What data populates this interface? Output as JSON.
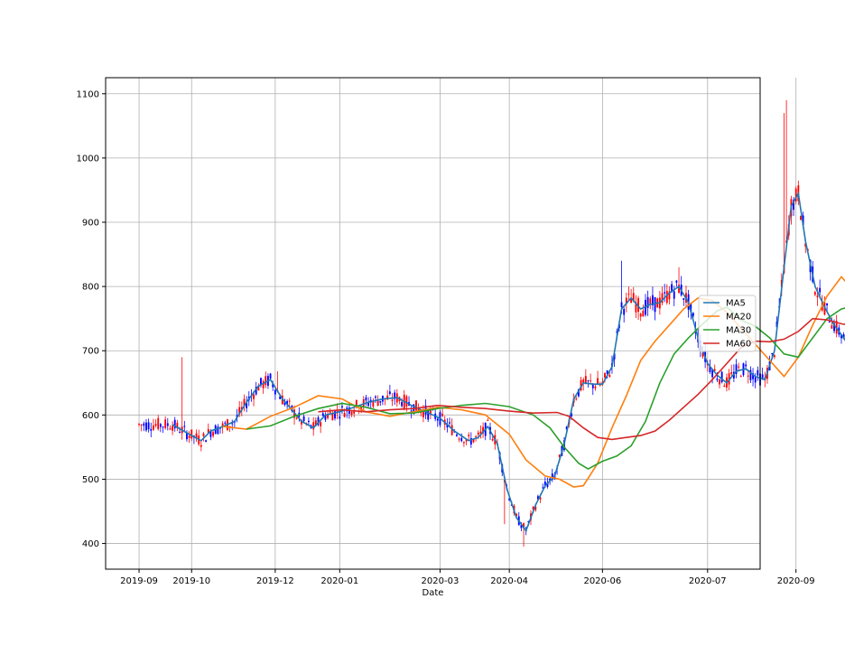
{
  "chart_data": {
    "type": "candlestick",
    "title": "",
    "xlabel": "Date",
    "ylabel": "",
    "ylim": [
      360,
      1125
    ],
    "yticks": [
      400,
      500,
      600,
      700,
      800,
      900,
      1000,
      1100
    ],
    "xticks": [
      "2019-09",
      "2019-10",
      "2019-12",
      "2020-01",
      "2020-03",
      "2020-04",
      "2020-06",
      "2020-07",
      "2020-09"
    ],
    "xlim": [
      -14,
      260
    ],
    "grid": true,
    "legend_position": "center-right",
    "colors": {
      "up": "#ff0000",
      "down": "#0000ff"
    },
    "series": [
      {
        "name": "MA5",
        "color": "#1f77b4",
        "points": [
          [
            14,
            585
          ],
          [
            20,
            572
          ],
          [
            26,
            560
          ],
          [
            30,
            575
          ],
          [
            35,
            582
          ],
          [
            40,
            590
          ],
          [
            45,
            620
          ],
          [
            50,
            645
          ],
          [
            55,
            655
          ],
          [
            60,
            625
          ],
          [
            64,
            608
          ],
          [
            68,
            590
          ],
          [
            73,
            580
          ],
          [
            78,
            600
          ],
          [
            84,
            605
          ],
          [
            90,
            612
          ],
          [
            96,
            620
          ],
          [
            102,
            625
          ],
          [
            108,
            627
          ],
          [
            114,
            615
          ],
          [
            120,
            605
          ],
          [
            126,
            595
          ],
          [
            132,
            575
          ],
          [
            138,
            560
          ],
          [
            142,
            565
          ],
          [
            146,
            582
          ],
          [
            150,
            555
          ],
          [
            154,
            485
          ],
          [
            158,
            440
          ],
          [
            162,
            420
          ],
          [
            166,
            460
          ],
          [
            170,
            490
          ],
          [
            174,
            505
          ],
          [
            178,
            555
          ],
          [
            182,
            625
          ],
          [
            186,
            650
          ],
          [
            190,
            648
          ],
          [
            194,
            648
          ],
          [
            198,
            675
          ],
          [
            202,
            765
          ],
          [
            206,
            782
          ],
          [
            210,
            765
          ],
          [
            214,
            772
          ],
          [
            218,
            775
          ],
          [
            222,
            790
          ],
          [
            226,
            800
          ],
          [
            230,
            775
          ],
          [
            234,
            720
          ],
          [
            238,
            680
          ],
          [
            242,
            662
          ],
          [
            246,
            650
          ],
          [
            250,
            668
          ],
          [
            254,
            672
          ],
          [
            258,
            660
          ],
          [
            262,
            655
          ],
          [
            266,
            700
          ],
          [
            270,
            830
          ],
          [
            273,
            925
          ],
          [
            276,
            945
          ],
          [
            279,
            870
          ],
          [
            283,
            800
          ],
          [
            287,
            768
          ],
          [
            291,
            740
          ],
          [
            295,
            720
          ],
          [
            299,
            695
          ],
          [
            303,
            685
          ],
          [
            307,
            688
          ],
          [
            311,
            700
          ],
          [
            315,
            720
          ],
          [
            320,
            880
          ],
          [
            325,
            900
          ]
        ]
      },
      {
        "name": "MA20",
        "color": "#ff7f0e",
        "points": [
          [
            35,
            582
          ],
          [
            45,
            578
          ],
          [
            55,
            598
          ],
          [
            65,
            612
          ],
          [
            75,
            630
          ],
          [
            85,
            625
          ],
          [
            95,
            605
          ],
          [
            105,
            598
          ],
          [
            115,
            605
          ],
          [
            125,
            612
          ],
          [
            135,
            608
          ],
          [
            145,
            600
          ],
          [
            155,
            570
          ],
          [
            162,
            530
          ],
          [
            170,
            505
          ],
          [
            176,
            500
          ],
          [
            182,
            488
          ],
          [
            186,
            490
          ],
          [
            192,
            525
          ],
          [
            198,
            580
          ],
          [
            204,
            630
          ],
          [
            210,
            685
          ],
          [
            216,
            715
          ],
          [
            222,
            740
          ],
          [
            228,
            765
          ],
          [
            234,
            782
          ],
          [
            240,
            778
          ],
          [
            246,
            760
          ],
          [
            252,
            735
          ],
          [
            258,
            710
          ],
          [
            264,
            685
          ],
          [
            270,
            660
          ],
          [
            276,
            690
          ],
          [
            282,
            740
          ],
          [
            288,
            785
          ],
          [
            294,
            815
          ],
          [
            300,
            790
          ],
          [
            306,
            740
          ],
          [
            312,
            742
          ]
        ]
      },
      {
        "name": "MA30",
        "color": "#2ca02c",
        "points": [
          [
            45,
            578
          ],
          [
            55,
            583
          ],
          [
            65,
            598
          ],
          [
            75,
            610
          ],
          [
            85,
            618
          ],
          [
            95,
            612
          ],
          [
            105,
            602
          ],
          [
            115,
            603
          ],
          [
            125,
            610
          ],
          [
            135,
            615
          ],
          [
            145,
            618
          ],
          [
            155,
            613
          ],
          [
            165,
            600
          ],
          [
            172,
            580
          ],
          [
            178,
            550
          ],
          [
            184,
            525
          ],
          [
            188,
            516
          ],
          [
            194,
            528
          ],
          [
            200,
            536
          ],
          [
            206,
            552
          ],
          [
            212,
            590
          ],
          [
            218,
            650
          ],
          [
            224,
            695
          ],
          [
            230,
            720
          ],
          [
            236,
            742
          ],
          [
            242,
            762
          ],
          [
            246,
            768
          ],
          [
            252,
            748
          ],
          [
            258,
            738
          ],
          [
            264,
            720
          ],
          [
            270,
            695
          ],
          [
            276,
            690
          ],
          [
            282,
            720
          ],
          [
            288,
            750
          ],
          [
            294,
            765
          ],
          [
            300,
            770
          ],
          [
            306,
            780
          ],
          [
            312,
            790
          ],
          [
            318,
            760
          ]
        ]
      },
      {
        "name": "MA60",
        "color": "#d62728",
        "points": [
          [
            75,
            605
          ],
          [
            85,
            608
          ],
          [
            95,
            605
          ],
          [
            105,
            608
          ],
          [
            115,
            610
          ],
          [
            125,
            615
          ],
          [
            135,
            612
          ],
          [
            145,
            610
          ],
          [
            155,
            606
          ],
          [
            165,
            603
          ],
          [
            175,
            604
          ],
          [
            180,
            598
          ],
          [
            186,
            580
          ],
          [
            192,
            565
          ],
          [
            198,
            562
          ],
          [
            204,
            565
          ],
          [
            210,
            568
          ],
          [
            216,
            575
          ],
          [
            222,
            592
          ],
          [
            228,
            612
          ],
          [
            234,
            632
          ],
          [
            240,
            655
          ],
          [
            246,
            680
          ],
          [
            252,
            705
          ],
          [
            258,
            715
          ],
          [
            264,
            714
          ],
          [
            270,
            718
          ],
          [
            276,
            730
          ],
          [
            282,
            750
          ],
          [
            288,
            748
          ],
          [
            294,
            742
          ],
          [
            300,
            738
          ],
          [
            306,
            732
          ],
          [
            312,
            728
          ]
        ]
      }
    ]
  }
}
